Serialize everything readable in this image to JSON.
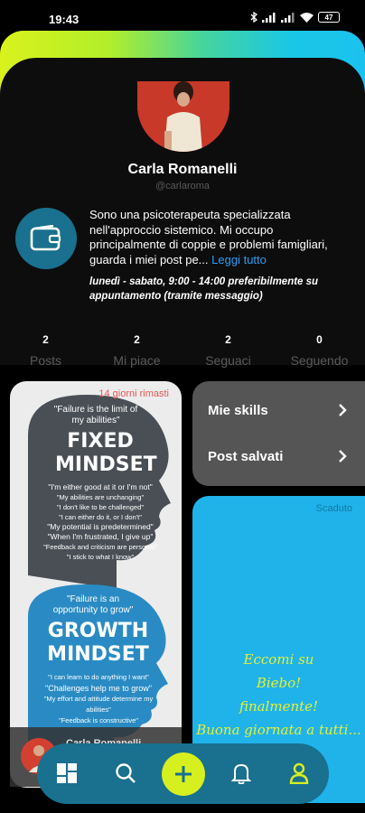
{
  "status": {
    "time": "19:43",
    "battery": "47"
  },
  "profile": {
    "name": "Carla Romanelli",
    "handle": "@carlaroma",
    "bio": "Sono una psicoterapeuta specializzata nell'approccio sistemico. Mi occupo principalmente di coppie e problemi famigliari, guarda i miei post pe...",
    "read_more": "Leggi tutto",
    "hours": "lunedì - sabato, 9:00 - 14:00 preferibilmente su appuntamento (tramite messaggio)"
  },
  "stats": [
    {
      "value": "2",
      "label": "Posts"
    },
    {
      "value": "2",
      "label": "Mi piace"
    },
    {
      "value": "2",
      "label": "Seguaci"
    },
    {
      "value": "0",
      "label": "Seguendo"
    }
  ],
  "post1": {
    "countdown": "14 giorni rimasti",
    "fixed_quote": "\"Failure is the limit of my abilities\"",
    "fixed_title": "FIXED MINDSET",
    "fixed_lines": [
      "\"I'm either good at it or I'm not\"",
      "\"My abilities are unchanging\"",
      "\"I don't like to be challenged\"",
      "\"I can either do it, or I don't\"",
      "\"My potential is predetermined\"",
      "\"When I'm frustrated, I give up\"",
      "\"Feedback and criticism are personal\"",
      "\"I stick to what I know\""
    ],
    "growth_quote": "\"Failure is an opportunity to grow\"",
    "growth_title": "GROWTH MINDSET",
    "growth_lines": [
      "\"I can learn to do anything I want\"",
      "\"Challenges help me to grow\"",
      "\"My effort and attitude determine my abilities\"",
      "\"Feedback is constructive\""
    ],
    "author": "Carla Romanelli"
  },
  "menu": [
    {
      "label": "Mie skills"
    },
    {
      "label": "Post salvati"
    }
  ],
  "post2": {
    "status": "Scaduto",
    "line1": "Eccomi su Biebo! finalmente!",
    "line2": "Buona giornata a tutti..."
  },
  "nav": {
    "items": [
      "grid-icon",
      "search-icon",
      "add-icon",
      "bell-icon",
      "profile-icon"
    ]
  },
  "colors": {
    "accent": "#d6ef1f",
    "teal": "#19708f",
    "link": "#2b9ef3",
    "blue_post": "#1fb3ea"
  }
}
